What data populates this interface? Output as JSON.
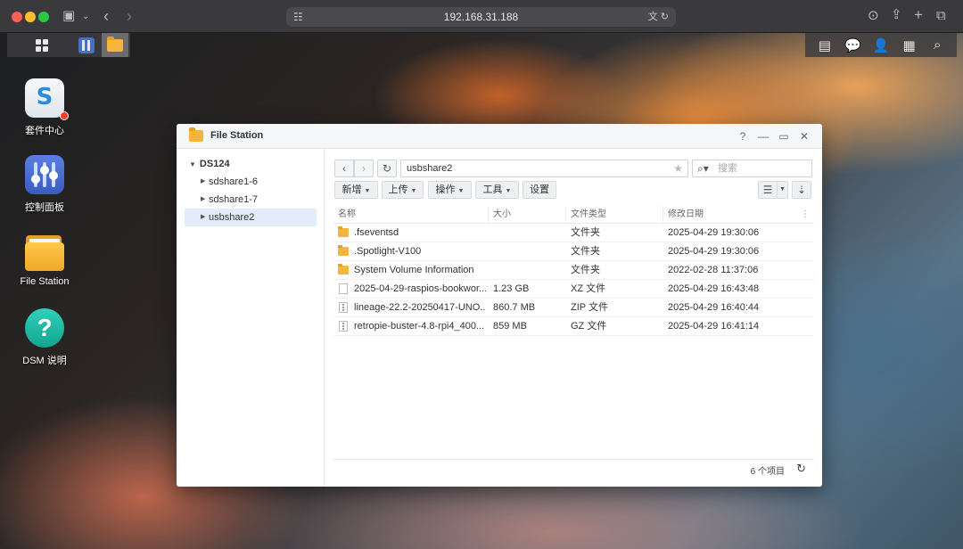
{
  "browser": {
    "address": "192.168.31.188",
    "icons": [
      "sidebar-icon",
      "back-icon",
      "forward-icon",
      "translate-icon",
      "reload-icon",
      "download-icon",
      "share-icon",
      "new-tab-icon",
      "tabs-overview-icon"
    ]
  },
  "desktop": {
    "icons": [
      {
        "label": "套件中心",
        "icon": "package-center-icon"
      },
      {
        "label": "控制面板",
        "icon": "control-panel-icon"
      },
      {
        "label": "File Station",
        "icon": "file-station-icon"
      },
      {
        "label": "DSM 说明",
        "icon": "dsm-help-icon"
      }
    ]
  },
  "window": {
    "title": "File Station",
    "controls": {
      "help": "?",
      "minimize": "—",
      "maximize": "▭",
      "close": "✕"
    },
    "tree": {
      "root": "DS124",
      "items": [
        {
          "label": "sdshare1-6",
          "selected": false
        },
        {
          "label": "sdshare1-7",
          "selected": false
        },
        {
          "label": "usbshare2",
          "selected": true
        }
      ]
    },
    "path": "usbshare2",
    "search_placeholder": "搜索",
    "toolbar": {
      "new": "新增",
      "upload": "上传",
      "action": "操作",
      "tools": "工具",
      "settings": "设置"
    },
    "columns": [
      "名称",
      "大小",
      "文件类型",
      "修改日期"
    ],
    "files": [
      {
        "name": ".fseventsd",
        "size": "",
        "type": "文件夹",
        "modified": "2025-04-29 19:30:06",
        "kind": "folder"
      },
      {
        "name": ".Spotlight-V100",
        "size": "",
        "type": "文件夹",
        "modified": "2025-04-29 19:30:06",
        "kind": "folder"
      },
      {
        "name": "System Volume Information",
        "size": "",
        "type": "文件夹",
        "modified": "2022-02-28 11:37:06",
        "kind": "folder"
      },
      {
        "name": "2025-04-29-raspios-bookwor...",
        "size": "1.23 GB",
        "type": "XZ 文件",
        "modified": "2025-04-29 16:43:48",
        "kind": "file"
      },
      {
        "name": "lineage-22.2-20250417-UNO...",
        "size": "860.7 MB",
        "type": "ZIP 文件",
        "modified": "2025-04-29 16:40:44",
        "kind": "archive"
      },
      {
        "name": "retropie-buster-4.8-rpi4_400...",
        "size": "859 MB",
        "type": "GZ 文件",
        "modified": "2025-04-29 16:41:14",
        "kind": "archive"
      }
    ],
    "item_count": "6 个项目"
  }
}
